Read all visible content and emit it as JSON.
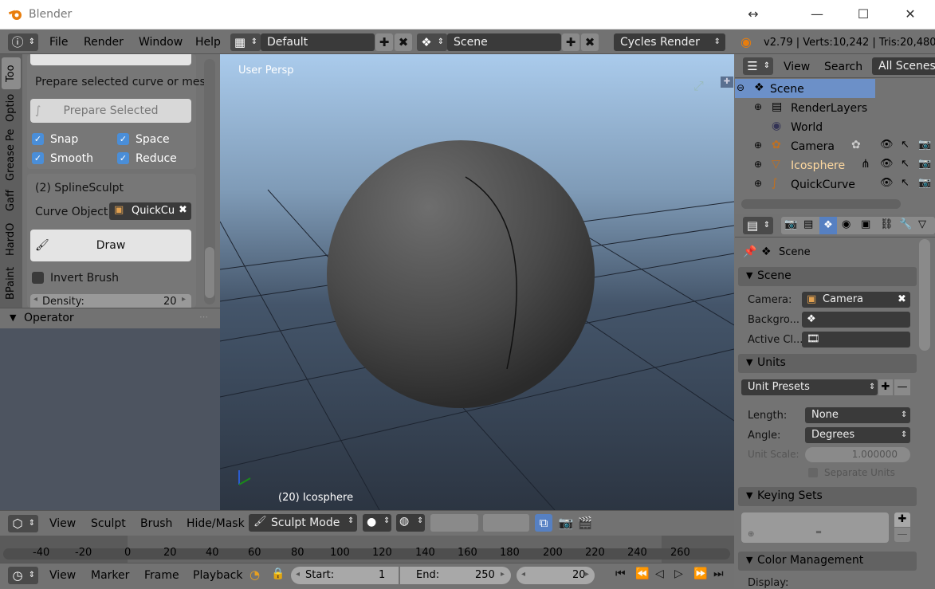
{
  "window": {
    "title": "Blender",
    "resize_glyph": "↔",
    "minimize": "—",
    "maximize": "☐",
    "close": "✕"
  },
  "menubar": {
    "items": [
      "File",
      "Render",
      "Window",
      "Help"
    ],
    "layout": "Default",
    "scene": "Scene",
    "engine": "Cycles Render",
    "stats": "v2.79 | Verts:10,242 | Tris:20,480"
  },
  "toolshelf": {
    "tabs": [
      "Too",
      "Optio",
      "Grease Pe",
      "Gaff",
      "HardO",
      "BPaint"
    ],
    "prepare_text": "Prepare selected curve or mesh",
    "prepare_button": "Prepare Selected",
    "checks": [
      {
        "label": "Snap",
        "checked": true
      },
      {
        "label": "Space",
        "checked": true
      },
      {
        "label": "Smooth",
        "checked": true
      },
      {
        "label": "Reduce",
        "checked": true
      }
    ],
    "spline_header": "(2) SplineSculpt",
    "curve_object_label": "Curve Object",
    "curve_object_value": "QuickCu",
    "draw_button": "Draw",
    "invert_brush_label": "Invert Brush",
    "invert_brush_checked": false,
    "density_label": "Density:",
    "density_value": "20"
  },
  "operator": {
    "title": "Operator"
  },
  "viewport": {
    "persp_label": "User Persp",
    "object_label": "(20) Icosphere"
  },
  "view3d_header": {
    "items": [
      "View",
      "Sculpt",
      "Brush",
      "Hide/Mask"
    ],
    "mode": "Sculpt Mode"
  },
  "timeline": {
    "ticks": [
      "-40",
      "-20",
      "0",
      "20",
      "40",
      "60",
      "80",
      "100",
      "120",
      "140",
      "160",
      "180",
      "200",
      "220",
      "240",
      "260"
    ]
  },
  "timeline_header": {
    "items": [
      "View",
      "Marker",
      "Frame",
      "Playback"
    ],
    "start_label": "Start:",
    "start_value": "1",
    "end_label": "End:",
    "end_value": "250",
    "current_frame": "20"
  },
  "outliner": {
    "menu": [
      "View",
      "Search"
    ],
    "filter": "All Scenes",
    "rows": [
      {
        "label": "Scene",
        "selected": true
      },
      {
        "label": "RenderLayers",
        "selected": false
      },
      {
        "label": "World",
        "selected": false
      },
      {
        "label": "Camera",
        "selected": false
      },
      {
        "label": "Icosphere",
        "selected": false,
        "highlight": true
      },
      {
        "label": "QuickCurve",
        "selected": false
      }
    ]
  },
  "properties": {
    "context": "Scene",
    "scene_panel": {
      "title": "Scene",
      "camera_label": "Camera:",
      "camera_value": "Camera",
      "background_label": "Backgro...",
      "active_clip_label": "Active Cl..."
    },
    "units_panel": {
      "title": "Units",
      "presets": "Unit Presets",
      "length_label": "Length:",
      "length_value": "None",
      "angle_label": "Angle:",
      "angle_value": "Degrees",
      "scale_label": "Unit Scale:",
      "scale_value": "1.000000",
      "separate_label": "Separate Units"
    },
    "keying_panel": {
      "title": "Keying Sets"
    },
    "color_panel": {
      "title": "Color Management",
      "display_label": "Display:"
    }
  },
  "colors": {
    "accent": "#5680c2",
    "selected_row": "#6c90c8",
    "highlight_text": "#ffd9a0",
    "checkbox": "#4a8ed8"
  }
}
